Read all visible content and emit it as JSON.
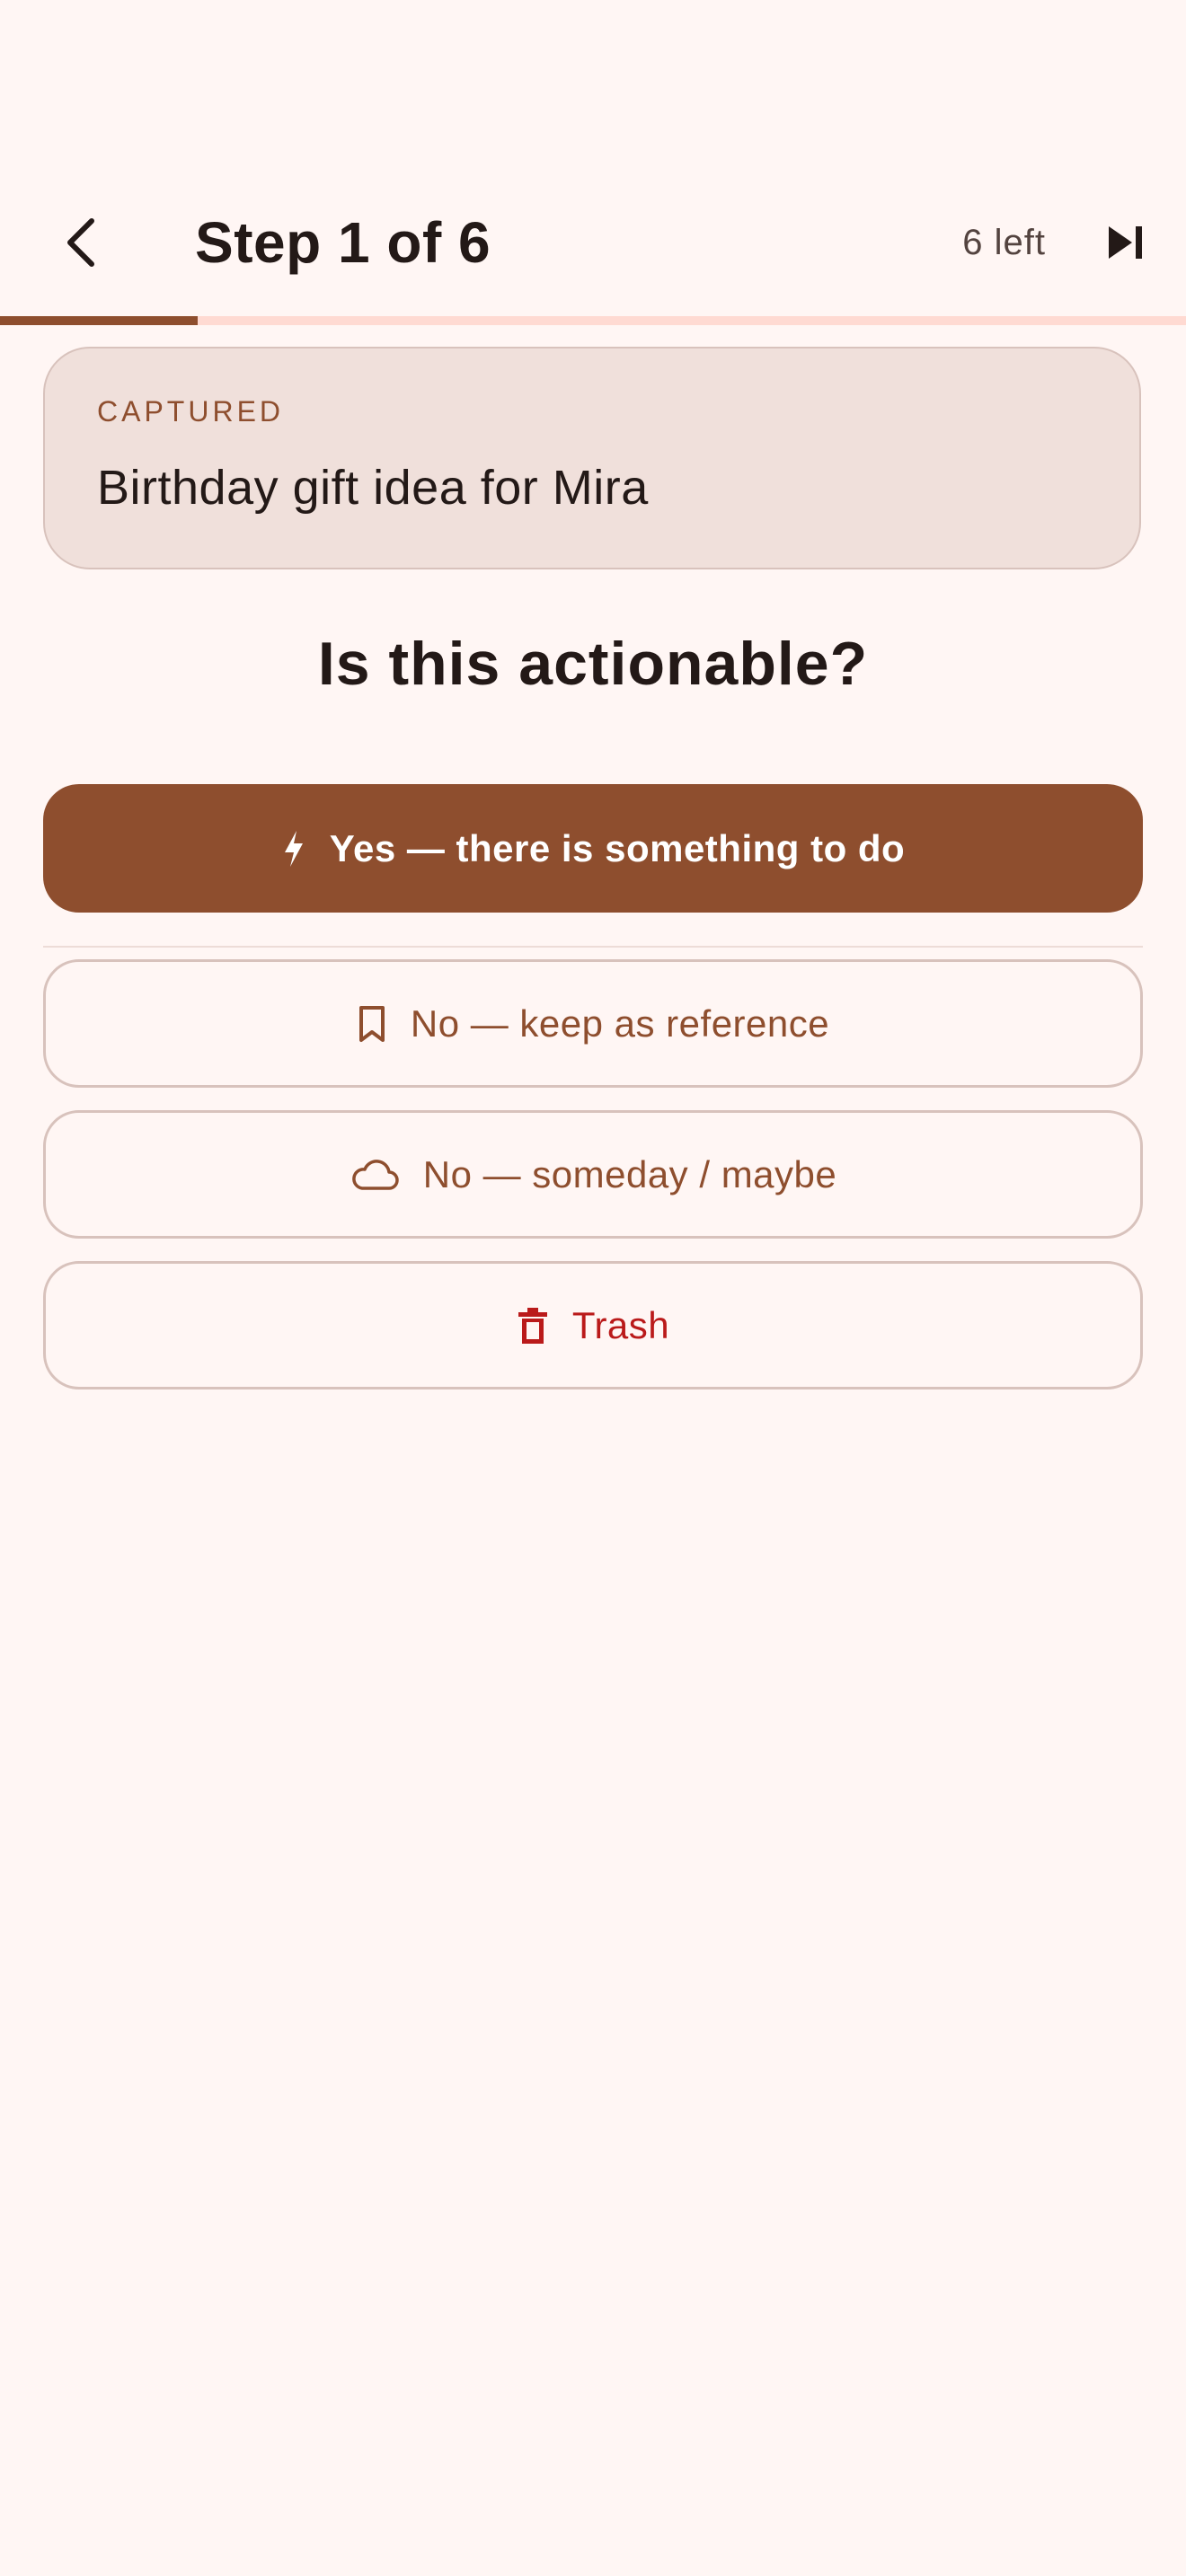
{
  "header": {
    "title": "Step 1 of 6",
    "remaining": "6 left",
    "back_icon": "arrow-back-icon",
    "skip_icon": "skip-next-icon"
  },
  "progress": {
    "current_step": 1,
    "total_steps": 6,
    "fraction": 0.167
  },
  "captured": {
    "label": "CAPTURED",
    "text": "Birthday gift idea for Mira"
  },
  "question": "Is this actionable?",
  "actions": {
    "yes": {
      "label": "Yes — there is something to do",
      "icon": "bolt-icon"
    },
    "reference": {
      "label": "No — keep as reference",
      "icon": "bookmark-icon"
    },
    "someday": {
      "label": "No — someday / maybe",
      "icon": "cloud-icon"
    },
    "trash": {
      "label": "Trash",
      "icon": "trash-icon"
    }
  },
  "colors": {
    "background": "#FFF6F4",
    "primary": "#8E4E2E",
    "card": "#F0E0DB",
    "outline": "#D8C2BC",
    "progress_track": "#FFDAD2",
    "danger": "#BA1A1A"
  }
}
